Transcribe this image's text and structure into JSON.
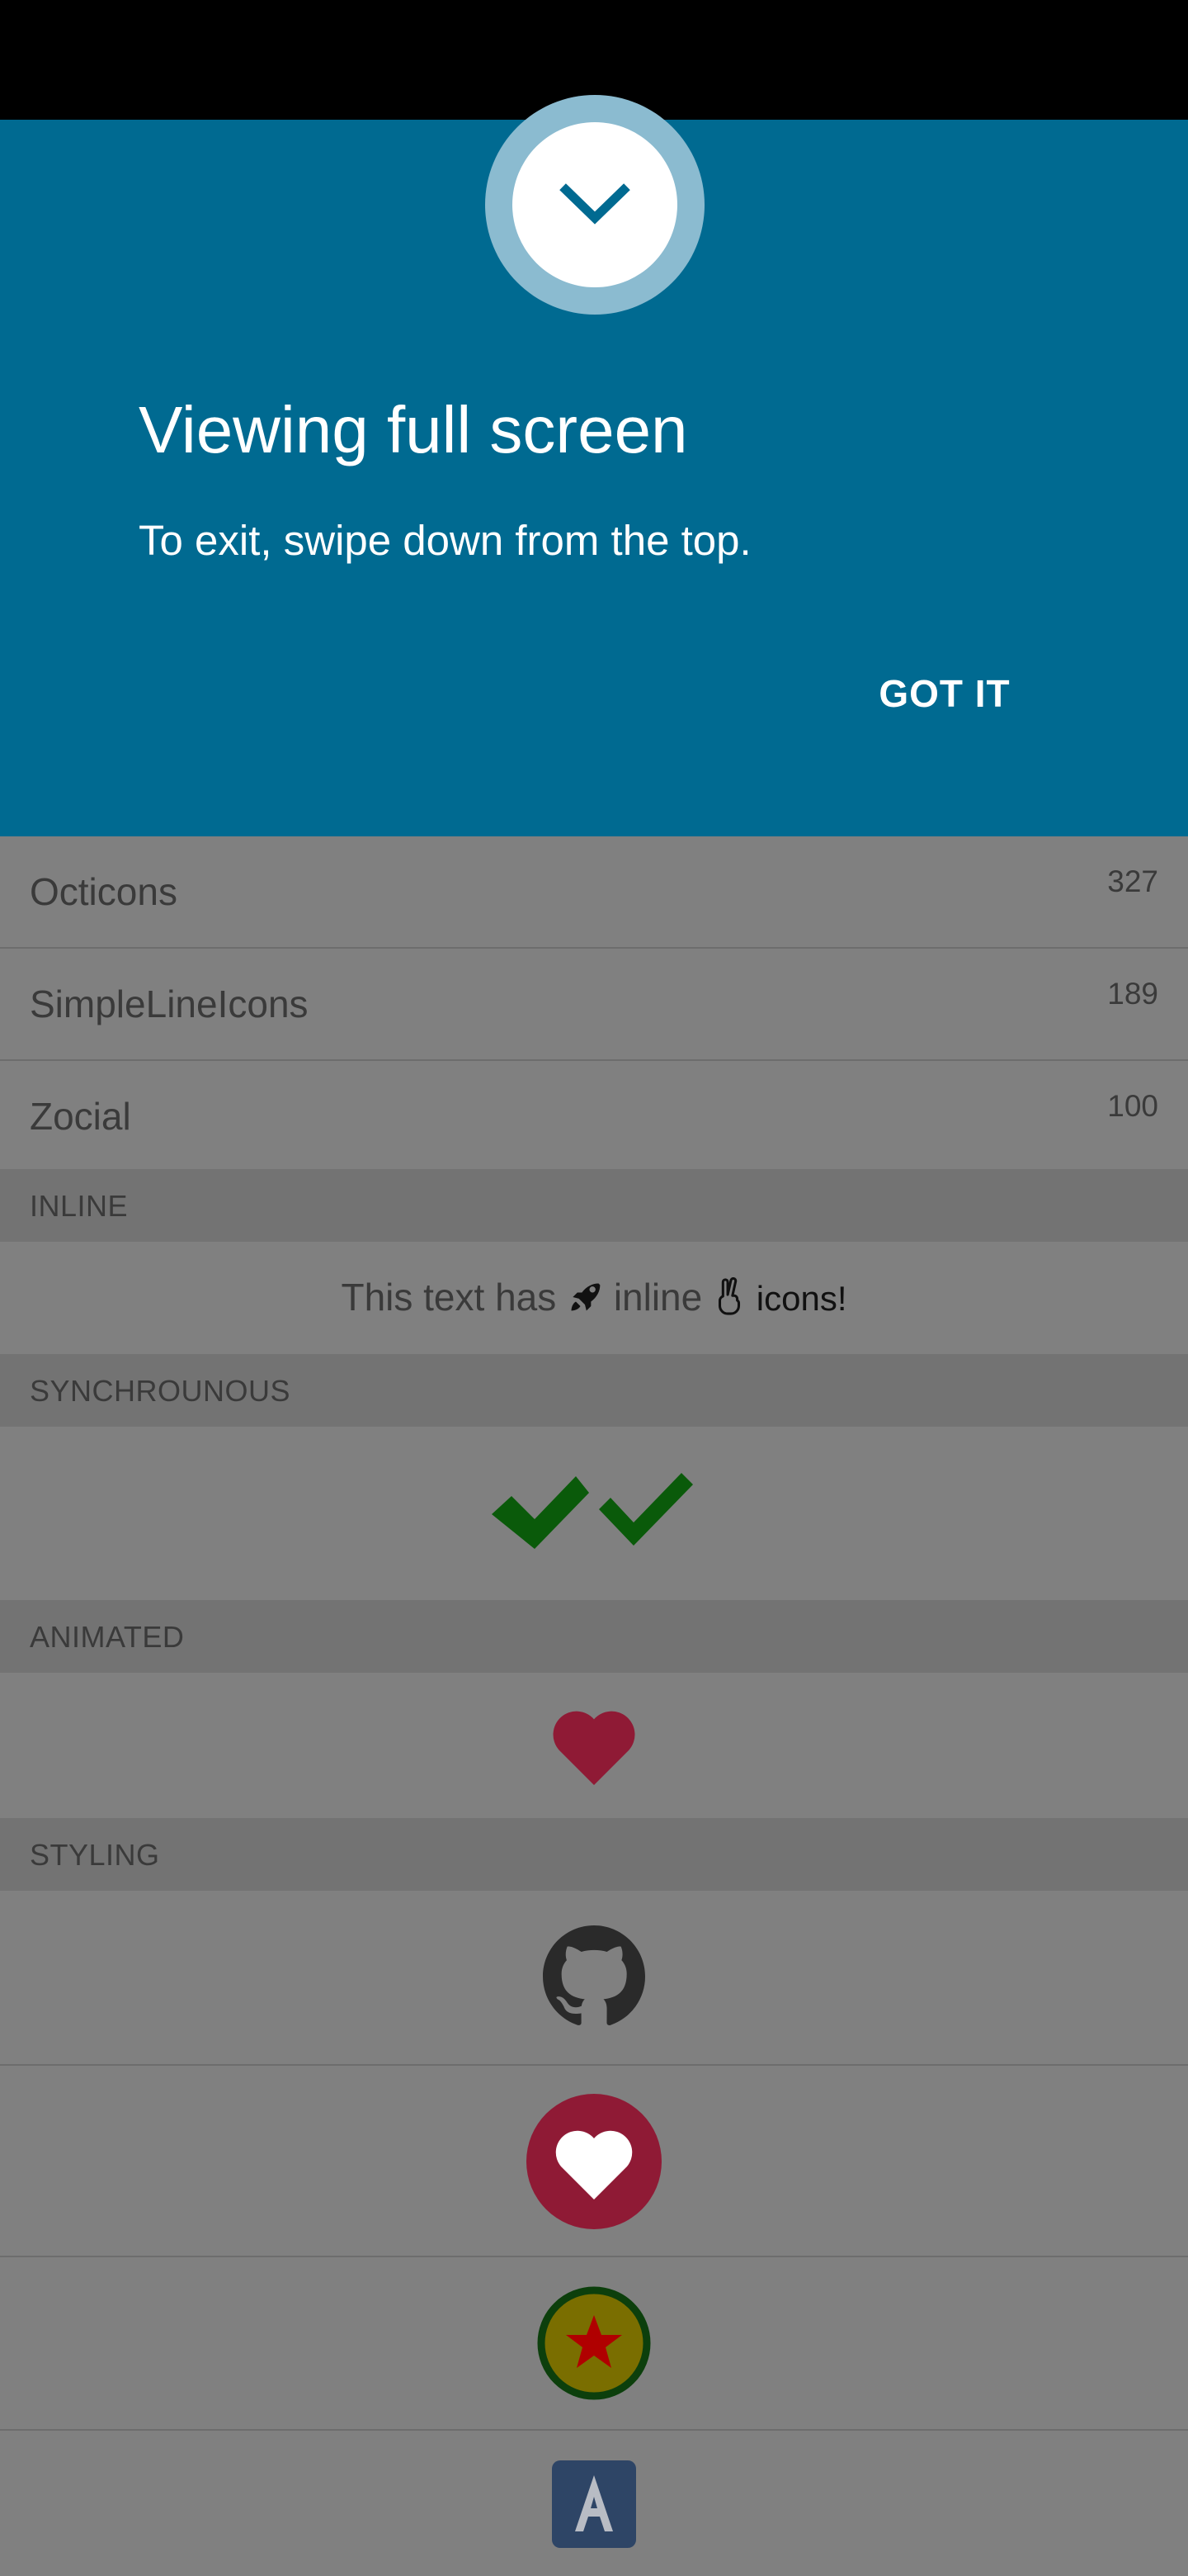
{
  "banner": {
    "title": "Viewing full screen",
    "subtitle": "To exit, swipe down from the top.",
    "action_label": "GOT IT",
    "icon": "chevron-down-icon",
    "background": "#006a91"
  },
  "icon_sets": [
    {
      "name": "Octicons",
      "count": "327"
    },
    {
      "name": "SimpleLineIcons",
      "count": "189"
    },
    {
      "name": "Zocial",
      "count": "100"
    }
  ],
  "sections": {
    "inline": {
      "header": "INLINE",
      "text_before": "This text has",
      "text_middle": "inline",
      "text_after": "icons!",
      "icons": [
        "rocket-icon",
        "hand-peace-icon"
      ]
    },
    "synchronous": {
      "header": "SYNCHROUNOUS",
      "icons": [
        "check-icon",
        "check-icon"
      ],
      "color": "#0a5a0a"
    },
    "animated": {
      "header": "ANIMATED",
      "icon": "heart-icon",
      "color": "#8f1a35"
    },
    "styling": {
      "header": "STYLING",
      "icons": [
        "github-icon",
        "heart-circle-icon",
        "star-circle-icon",
        "font-a-icon"
      ]
    }
  }
}
